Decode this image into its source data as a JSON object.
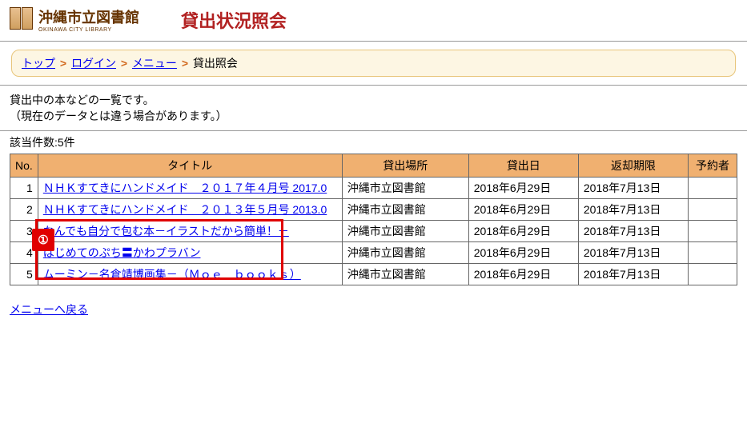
{
  "header": {
    "logo_title": "沖縄市立図書館",
    "logo_subtitle": "OKINAWA CITY LIBRARY",
    "page_title": "貸出状況照会"
  },
  "breadcrumb": {
    "items": [
      {
        "label": "トップ",
        "link": true
      },
      {
        "label": "ログイン",
        "link": true
      },
      {
        "label": "メニュー",
        "link": true
      },
      {
        "label": "貸出照会",
        "link": false
      }
    ]
  },
  "description": {
    "line1": "貸出中の本などの一覧です。",
    "line2": "（現在のデータとは違う場合があります。）"
  },
  "result_count": "該当件数:5件",
  "table": {
    "headers": [
      "No.",
      "タイトル",
      "貸出場所",
      "貸出日",
      "返却期限",
      "予約者"
    ],
    "rows": [
      {
        "no": "1",
        "title": "ＮＨＫすてきにハンドメイド　２０１７年４月号 2017.0",
        "place": "沖縄市立図書館",
        "checkout": "2018年6月29日",
        "due": "2018年7月13日",
        "reserve": ""
      },
      {
        "no": "2",
        "title": "ＮＨＫすてきにハンドメイド　２０１３年５月号 2013.0",
        "place": "沖縄市立図書館",
        "checkout": "2018年6月29日",
        "due": "2018年7月13日",
        "reserve": ""
      },
      {
        "no": "3",
        "title": "なんでも自分で包む本－イラストだから簡単！－",
        "place": "沖縄市立図書館",
        "checkout": "2018年6月29日",
        "due": "2018年7月13日",
        "reserve": ""
      },
      {
        "no": "4",
        "title": "はじめてのぷち〓かわプラバン",
        "place": "沖縄市立図書館",
        "checkout": "2018年6月29日",
        "due": "2018年7月13日",
        "reserve": ""
      },
      {
        "no": "5",
        "title": "ムーミン－名倉靖博画集－（Ｍｏｅ　ｂｏｏｋｓ）",
        "place": "沖縄市立図書館",
        "checkout": "2018年6月29日",
        "due": "2018年7月13日",
        "reserve": ""
      }
    ]
  },
  "back_link": "メニューへ戻る",
  "annotation": {
    "badge": "①"
  }
}
